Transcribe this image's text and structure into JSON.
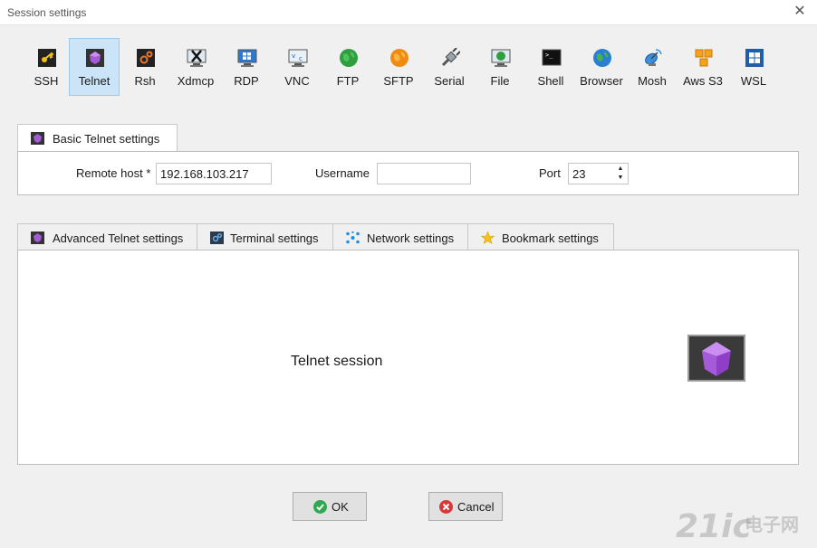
{
  "window": {
    "title": "Session settings"
  },
  "protocols": [
    {
      "label": "SSH",
      "icon": "ssh-key-icon"
    },
    {
      "label": "Telnet",
      "icon": "telnet-gem-icon",
      "selected": true
    },
    {
      "label": "Rsh",
      "icon": "rsh-gear-icon"
    },
    {
      "label": "Xdmcp",
      "icon": "xdmcp-x-monitor-icon"
    },
    {
      "label": "RDP",
      "icon": "rdp-windows-monitor-icon"
    },
    {
      "label": "VNC",
      "icon": "vnc-monitor-icon"
    },
    {
      "label": "FTP",
      "icon": "ftp-globe-icon"
    },
    {
      "label": "SFTP",
      "icon": "sftp-globe-icon"
    },
    {
      "label": "Serial",
      "icon": "serial-plug-icon"
    },
    {
      "label": "File",
      "icon": "file-globe-monitor-icon"
    },
    {
      "label": "Shell",
      "icon": "shell-terminal-icon"
    },
    {
      "label": "Browser",
      "icon": "browser-globe-icon"
    },
    {
      "label": "Mosh",
      "icon": "mosh-satellite-icon"
    },
    {
      "label": "Aws S3",
      "icon": "aws-s3-cubes-icon"
    },
    {
      "label": "WSL",
      "icon": "wsl-windows-icon"
    }
  ],
  "basic": {
    "tab_label": "Basic Telnet settings",
    "remote_host_label": "Remote host *",
    "remote_host_value": "192.168.103.217",
    "username_label": "Username",
    "username_value": "",
    "port_label": "Port",
    "port_value": "23"
  },
  "advanced_tabs": [
    {
      "label": "Advanced Telnet settings",
      "icon": "telnet-gem-icon"
    },
    {
      "label": "Terminal settings",
      "icon": "terminal-settings-icon"
    },
    {
      "label": "Network settings",
      "icon": "network-icon"
    },
    {
      "label": "Bookmark settings",
      "icon": "star-icon"
    }
  ],
  "session_panel": {
    "label": "Telnet session",
    "icon": "telnet-large-gem-icon"
  },
  "buttons": {
    "ok": "OK",
    "cancel": "Cancel"
  },
  "watermark": {
    "text": "21ic",
    "sub": "电子网"
  },
  "colors": {
    "selected_bg": "#cce4f7",
    "selected_border": "#99c9ef",
    "ok_green": "#2fa84f",
    "cancel_red": "#d93838",
    "telnet_purple": "#9b4dca"
  }
}
